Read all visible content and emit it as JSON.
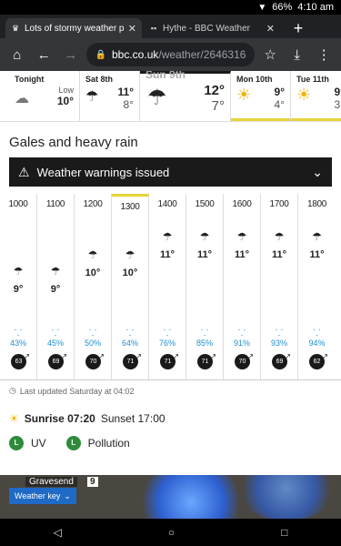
{
  "status": {
    "battery": "66%",
    "time": "4:10 am"
  },
  "tabs": [
    {
      "title": "Lots of stormy weather pote",
      "active": true
    },
    {
      "title": "Hythe - BBC Weather",
      "active": false
    }
  ],
  "newtab_label": "+",
  "url": {
    "domain": "bbc.co.uk",
    "path": "/weather/2646316"
  },
  "days": [
    {
      "name": "Tonight",
      "low_label": "Low",
      "low": "10°"
    },
    {
      "name": "Sat 8th",
      "hi": "11°",
      "lo": "8°"
    },
    {
      "name": "Sun 9th",
      "hi": "12°",
      "lo": "7°"
    },
    {
      "name": "Mon 10th",
      "hi": "9°",
      "lo": "4°"
    },
    {
      "name": "Tue 11th",
      "hi": "9°",
      "lo": "3°"
    }
  ],
  "heading": "Gales and heavy rain",
  "warning": "Weather warnings issued",
  "hours": [
    {
      "time": "1000",
      "temp": "9°",
      "pct": "43%",
      "wind": "63"
    },
    {
      "time": "1100",
      "temp": "9°",
      "pct": "45%",
      "wind": "69"
    },
    {
      "time": "1200",
      "temp": "10°",
      "pct": "50%",
      "wind": "70"
    },
    {
      "time": "1300",
      "temp": "10°",
      "pct": "64%",
      "wind": "71"
    },
    {
      "time": "1400",
      "temp": "11°",
      "pct": "76%",
      "wind": "71"
    },
    {
      "time": "1500",
      "temp": "11°",
      "pct": "85%",
      "wind": "71"
    },
    {
      "time": "1600",
      "temp": "11°",
      "pct": "91%",
      "wind": "70"
    },
    {
      "time": "1700",
      "temp": "11°",
      "pct": "93%",
      "wind": "69"
    },
    {
      "time": "1800",
      "temp": "11°",
      "pct": "94%",
      "wind": "62"
    }
  ],
  "updated": "Last updated Saturday at 04:02",
  "sunrise": "Sunrise 07:20",
  "sunset": "Sunset 17:00",
  "indices": [
    {
      "badge": "L",
      "label": "UV"
    },
    {
      "badge": "L",
      "label": "Pollution"
    }
  ],
  "map": {
    "place": "Gravesend",
    "place_num": "9",
    "key_label": "Weather key"
  },
  "colors": {
    "rain": "#1f8fd3",
    "accent": "#e6d43a",
    "badge": "#2e8b3a"
  }
}
